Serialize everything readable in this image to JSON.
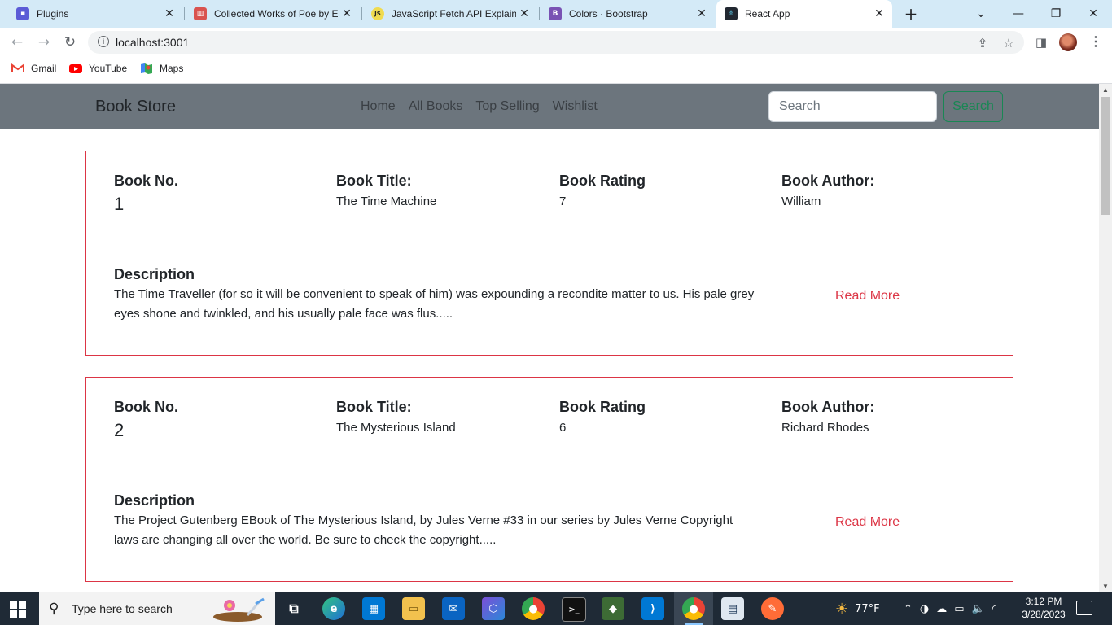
{
  "browser": {
    "tabs": [
      {
        "title": "Plugins",
        "favicon": "plugins-icon",
        "color": "#5b5bd6"
      },
      {
        "title": "Collected Works of Poe by Ed",
        "favicon": "book-icon",
        "color": "#d9534f"
      },
      {
        "title": "JavaScript Fetch API Explaine",
        "favicon": "js-icon",
        "color": "#f0db4f"
      },
      {
        "title": "Colors · Bootstrap",
        "favicon": "bootstrap-icon",
        "color": "#7952b3"
      },
      {
        "title": "React App",
        "favicon": "react-icon",
        "color": "#222831"
      }
    ],
    "address": "localhost:3001",
    "bookmarks": [
      {
        "label": "Gmail",
        "icon": "gmail-icon"
      },
      {
        "label": "YouTube",
        "icon": "youtube-icon"
      },
      {
        "label": "Maps",
        "icon": "maps-icon"
      }
    ]
  },
  "app": {
    "brand": "Book Store",
    "nav": [
      "Home",
      "All Books",
      "Top Selling",
      "Wishlist"
    ],
    "search_placeholder": "Search",
    "search_button": "Search",
    "labels": {
      "book_no": "Book No.",
      "title": "Book Title:",
      "rating": "Book Rating",
      "author": "Book Author:",
      "description": "Description",
      "read_more": "Read More"
    },
    "books": [
      {
        "no": "1",
        "title": "The Time Machine",
        "rating": "7",
        "author": "William",
        "description": "The Time Traveller (for so it will be convenient to speak of him) was expounding a recondite matter to us. His pale grey eyes shone and twinkled, and his usually pale face was flus....."
      },
      {
        "no": "2",
        "title": "The Mysterious Island",
        "rating": "6",
        "author": "Richard Rhodes",
        "description": "The Project Gutenberg EBook of The Mysterious Island, by Jules Verne #33 in our series by Jules Verne Copyright laws are changing all over the world. Be sure to check the copyright....."
      }
    ]
  },
  "taskbar": {
    "search_text": "Type here to search",
    "weather": "77°F",
    "time": "3:12 PM",
    "date": "3/28/2023"
  },
  "colors": {
    "accent_red": "#dc3545",
    "navbar_gray": "#6c757d",
    "success_green": "#198754"
  }
}
